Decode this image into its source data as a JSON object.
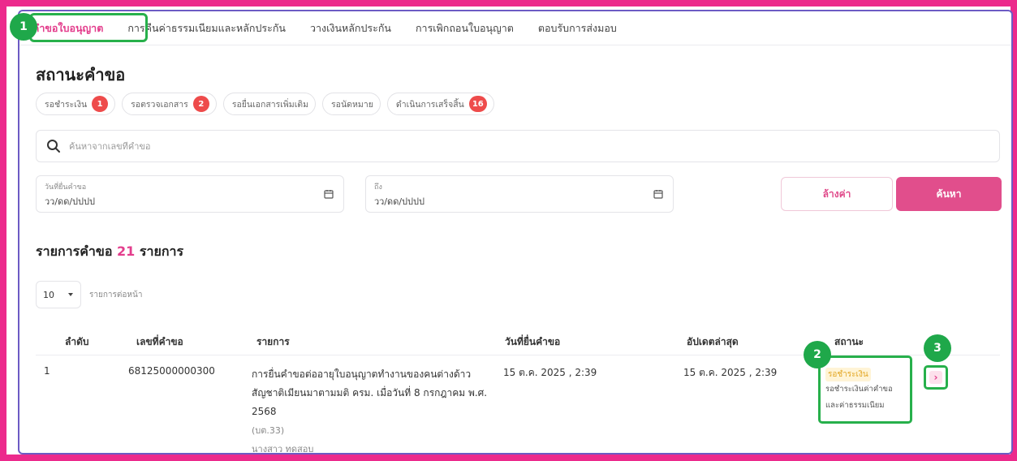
{
  "tabs": [
    {
      "label": "คำขอใบอนุญาต",
      "active": true
    },
    {
      "label": "การคืนค่าธรรมเนียมและหลักประกัน",
      "active": false
    },
    {
      "label": "วางเงินหลักประกัน",
      "active": false
    },
    {
      "label": "การเพิกถอนใบอนุญาต",
      "active": false
    },
    {
      "label": "ตอบรับการส่งมอบ",
      "active": false
    }
  ],
  "markers": [
    "1",
    "2",
    "3"
  ],
  "status_section": {
    "title": "สถานะคำขอ",
    "chips": [
      {
        "label": "รอชำระเงิน",
        "count": "1"
      },
      {
        "label": "รอตรวจเอกสาร",
        "count": "2"
      },
      {
        "label": "รอยื่นเอกสารเพิ่มเติม",
        "count": ""
      },
      {
        "label": "รอนัดหมาย",
        "count": ""
      },
      {
        "label": "ดำเนินการเสร็จสิ้น",
        "count": "16"
      }
    ]
  },
  "search": {
    "placeholder": "ค้นหาจากเลขที่คำขอ",
    "icon": "search-icon"
  },
  "date_from": {
    "label": "วันที่ยื่นคำขอ",
    "placeholder": "วว/ดด/ปปปป"
  },
  "date_to": {
    "label": "ถึง",
    "placeholder": "วว/ดด/ปปปป"
  },
  "buttons": {
    "clear": "ล้างค่า",
    "search": "ค้นหา"
  },
  "list": {
    "title_prefix": "รายการคำขอ",
    "count": "21",
    "title_suffix": "รายการ"
  },
  "per_page": {
    "value": "10",
    "label": "รายการต่อหน้า"
  },
  "table": {
    "headers": [
      "ลำดับ",
      "เลขที่คำขอ",
      "รายการ",
      "วันที่ยื่นคำขอ",
      "อัปเดตล่าสุด",
      "สถานะ"
    ],
    "rows": [
      {
        "index": "1",
        "request_no": "68125000000300",
        "title": "การยื่นคำขอต่ออายุใบอนุญาตทำงานของคนต่างด้าวสัญชาติเมียนมาตามมติ ครม. เมื่อวันที่ 8 กรกฎาคม พ.ศ. 2568",
        "form_code": "(บต.33)",
        "applicant": "นางสาว ทดสอบ",
        "submitted": "15 ต.ค. 2025 , 2:39",
        "updated": "15 ต.ค. 2025 , 2:39",
        "status": "รอชำระเงิน",
        "status_detail_1": "รอชำระเงินค่าคำขอ",
        "status_detail_2": "และค่าธรรมเนียม"
      }
    ]
  },
  "colors": {
    "accent": "#e33d8c",
    "highlight": "#27b04b",
    "frame": "#6c5bc4",
    "page_bg": "#ec2a8c"
  }
}
